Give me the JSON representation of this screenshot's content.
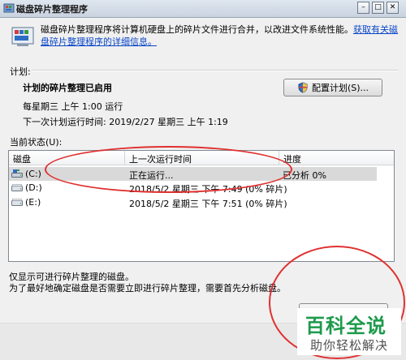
{
  "window": {
    "title": "磁盘碎片整理程序",
    "minimize": "–",
    "maximize": "□",
    "close": "✕"
  },
  "intro": {
    "text": "磁盘碎片整理程序将计算机硬盘上的碎片文件进行合并，以改进文件系统性能。",
    "link": "获取有关磁盘碎片整理程序的详细信息。"
  },
  "schedule": {
    "label": "计划:",
    "status": "计划的碎片整理已启用",
    "frequency": "每星期三 上午 1:00 运行",
    "next_run": "下一次计划运行时间: 2019/2/27 星期三 上午 1:19",
    "configure_button": "配置计划(S)..."
  },
  "current": {
    "label": "当前状态(U):"
  },
  "table": {
    "columns": [
      "磁盘",
      "上一次运行时间",
      "进度"
    ],
    "rows": [
      {
        "disk": "(C:)",
        "last_run": "正在运行...",
        "progress": "已分析 0%"
      },
      {
        "disk": "(D:)",
        "last_run": "2018/5/2 星期三 下午 7:49 (0% 碎片)",
        "progress": ""
      },
      {
        "disk": "(E:)",
        "last_run": "2018/5/2 星期三 下午 7:51 (0% 碎片)",
        "progress": ""
      }
    ]
  },
  "notes": {
    "line1": "仅显示可进行碎片整理的磁盘。",
    "line2": "为了最好地确定磁盘是否需要立即进行碎片整理，需要首先分析磁盘。"
  },
  "watermark": {
    "line1": "百科全说",
    "line2": "助你轻松解决"
  },
  "colors": {
    "annotation": "#e03030",
    "link": "#0a46c8",
    "watermark_green": "#1d9a4b"
  }
}
